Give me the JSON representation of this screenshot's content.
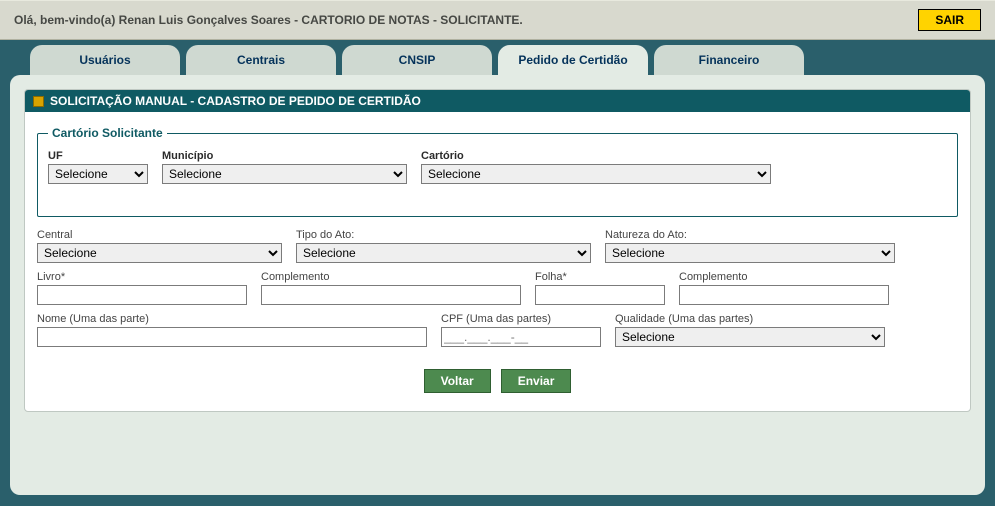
{
  "topbar": {
    "welcome": "Olá, bem-vindo(a) Renan Luis Gonçalves Soares - CARTORIO DE NOTAS - SOLICITANTE.",
    "exit": "SAIR"
  },
  "tabs": {
    "usuarios": "Usuários",
    "centrais": "Centrais",
    "cnsip": "CNSIP",
    "pedido": "Pedido de Certidão",
    "financeiro": "Financeiro"
  },
  "panel": {
    "title": "SOLICITAÇÃO MANUAL - CADASTRO DE PEDIDO DE CERTIDÃO"
  },
  "fieldset": {
    "legend": "Cartório Solicitante",
    "uf": {
      "label": "UF",
      "value": "Selecione"
    },
    "municipio": {
      "label": "Município",
      "value": "Selecione"
    },
    "cartorio": {
      "label": "Cartório",
      "value": "Selecione"
    }
  },
  "form": {
    "central": {
      "label": "Central",
      "value": "Selecione"
    },
    "tipoAto": {
      "label": "Tipo do Ato:",
      "value": "Selecione"
    },
    "naturezaAto": {
      "label": "Natureza do Ato:",
      "value": "Selecione"
    },
    "livro": {
      "label": "Livro*",
      "value": ""
    },
    "complemento1": {
      "label": "Complemento",
      "value": ""
    },
    "folha": {
      "label": "Folha*",
      "value": ""
    },
    "complemento2": {
      "label": "Complemento",
      "value": ""
    },
    "nome": {
      "label": "Nome (Uma das parte)",
      "value": ""
    },
    "cpf": {
      "label": "CPF (Uma das partes)",
      "value": "",
      "placeholder": "___.___.___-__"
    },
    "qualidade": {
      "label": "Qualidade (Uma das partes)",
      "value": "Selecione"
    }
  },
  "actions": {
    "voltar": "Voltar",
    "enviar": "Enviar"
  }
}
